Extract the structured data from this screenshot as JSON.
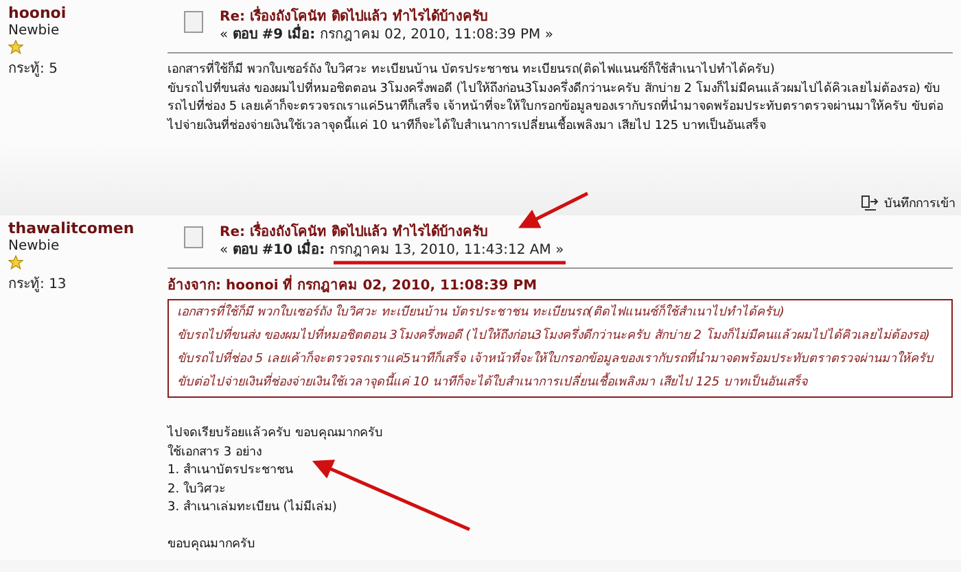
{
  "posts": [
    {
      "author": "hoonoi",
      "rank": "Newbie",
      "posts_label": "กระทู้:",
      "posts_count": "5",
      "title": "Re: เรื่องถังโคนัท ติดไปแล้ว ทำไรได้บ้างครับ",
      "reply_label": "ตอบ #9 เมื่อ:",
      "date": "กรกฎาคม 02, 2010, 11:08:39 PM",
      "body": [
        "เอกสารที่ใช้ก็มี พวกใบเซอร์ถัง ใบวิศวะ ทะเบียนบ้าน บัตรประชาชน ทะเบียนรถ(ติดไฟแนนซ์ก็ใช้สำเนาไปทำได้ครับ)",
        "ขับรถไปที่ขนส่ง ของผมไปที่หมอชิตตอน 3โมงครึ่งพอดี (ไปให้ถึงก่อน3โมงครึ่งดีกว่านะครับ สักบ่าย 2 โมงก็ไม่มีคนแล้วผมไปได้คิวเลยไม่ต้องรอ) ขับรถไปที่ช่อง 5 เลยเค้าก็จะตรวจรถเราแค่5นาทีก็เสร็จ เจ้าหน้าที่จะให้ใบกรอกข้อมูลของเรากับรถที่นำมาจดพร้อมประทับตราตรวจผ่านมาให้ครับ ขับต่อไปจ่ายเงินที่ช่องจ่ายเงินใช้เวลาจุดนี้แค่ 10 นาทีก็จะได้ใบสำเนาการเปลี่ยนเชื้อเพลิงมา เสียไป 125 บาทเป็นอันเสร็จ"
      ],
      "footer_link": "บันทึกการเข้า",
      "open_mark": "«",
      "close_mark": "»"
    },
    {
      "author": "thawalitcomen",
      "rank": "Newbie",
      "posts_label": "กระทู้:",
      "posts_count": "13",
      "title": "Re: เรื่องถังโคนัท ติดไปแล้ว ทำไรได้บ้างครับ",
      "reply_label": "ตอบ #10 เมื่อ:",
      "date": "กรกฎาคม 13, 2010, 11:43:12 AM",
      "quote": {
        "header": "อ้างจาก: hoonoi ที่ กรกฎาคม 02, 2010, 11:08:39 PM",
        "body": [
          "เอกสารที่ใช้ก็มี พวกใบเซอร์ถัง ใบวิศวะ ทะเบียนบ้าน บัตรประชาชน ทะเบียนรถ(ติดไฟแนนซ์ก็ใช้สำเนาไปทำได้ครับ)",
          "ขับรถไปที่ขนส่ง ของผมไปที่หมอชิตตอน 3โมงครึ่งพอดี (ไปให้ถึงก่อน3โมงครึ่งดีกว่านะครับ สักบ่าย 2 โมงก็ไม่มีคนแล้วผมไปได้คิวเลยไม่ต้องรอ) ขับรถไปที่ช่อง 5 เลยเค้าก็จะตรวจรถเราแค่5นาทีก็เสร็จ เจ้าหน้าที่จะให้ใบกรอกข้อมูลของเรากับรถที่นำมาจดพร้อมประทับตราตรวจผ่านมาให้ครับ ขับต่อไปจ่ายเงินที่ช่องจ่ายเงินใช้เวลาจุดนี้แค่ 10 นาทีก็จะได้ใบสำเนาการเปลี่ยนเชื้อเพลิงมา เสียไป 125 บาทเป็นอันเสร็จ"
        ]
      },
      "body": [
        "ไปจดเรียบร้อยแล้วครับ ขอบคุณมากครับ",
        "ใช้เอกสาร 3 อย่าง",
        "1. สำเนาบัตรประชาชน",
        "2. ใบวิศวะ",
        "3. สำเนาเล่มทะเบียน (ไม่มีเล่ม)"
      ],
      "closing": "ขอบคุณมากครับ",
      "open_mark": "«",
      "close_mark": "»"
    }
  ]
}
